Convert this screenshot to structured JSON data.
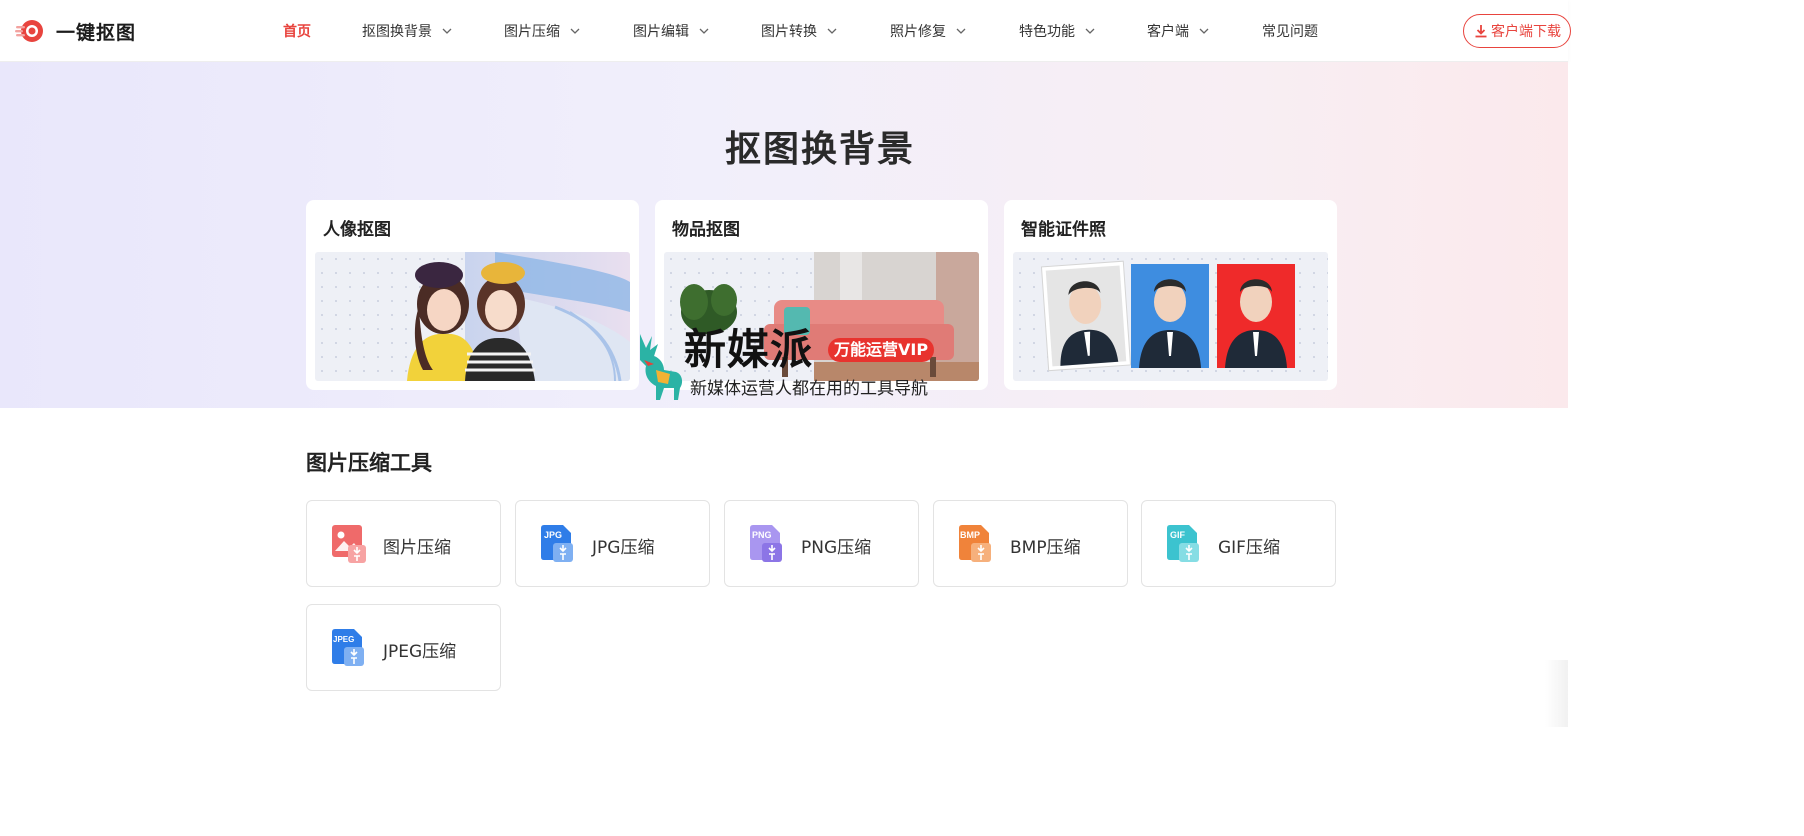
{
  "header": {
    "logo_text": "一键抠图",
    "nav": [
      {
        "label": "首页",
        "dropdown": false,
        "active": true
      },
      {
        "label": "抠图换背景",
        "dropdown": true
      },
      {
        "label": "图片压缩",
        "dropdown": true
      },
      {
        "label": "图片编辑",
        "dropdown": true
      },
      {
        "label": "图片转换",
        "dropdown": true
      },
      {
        "label": "照片修复",
        "dropdown": true
      },
      {
        "label": "特色功能",
        "dropdown": true
      },
      {
        "label": "客户端",
        "dropdown": true
      },
      {
        "label": "常见问题",
        "dropdown": false
      }
    ],
    "download_label": "客户端下载"
  },
  "hero": {
    "title": "抠图换背景",
    "cards": [
      {
        "title": "人像抠图",
        "image": "two-girls-portrait"
      },
      {
        "title": "物品抠图",
        "image": "pink-sofa-plant"
      },
      {
        "title": "智能证件照",
        "image": "id-photos-white-blue-red"
      }
    ]
  },
  "watermark": {
    "title": "新媒派",
    "badge": "万能运营VIP",
    "subtitle": "新媒体运营人都在用的工具导航"
  },
  "compress": {
    "title": "图片压缩工具",
    "tools": [
      {
        "label": "图片压缩",
        "icon": "image-compress-icon",
        "tag": "",
        "color": "#ef6a6a"
      },
      {
        "label": "JPG压缩",
        "icon": "jpg-compress-icon",
        "tag": "JPG",
        "color": "#2f7de8"
      },
      {
        "label": "PNG压缩",
        "icon": "png-compress-icon",
        "tag": "PNG",
        "color": "#9a86ec"
      },
      {
        "label": "BMP压缩",
        "icon": "bmp-compress-icon",
        "tag": "BMP",
        "color": "#f0833a"
      },
      {
        "label": "GIF压缩",
        "icon": "gif-compress-icon",
        "tag": "GIF",
        "color": "#3cc3cf"
      },
      {
        "label": "JPEG压缩",
        "icon": "jpeg-compress-icon",
        "tag": "JPEG",
        "color": "#2f7de8"
      }
    ]
  },
  "colors": {
    "accent": "#e8443e"
  }
}
